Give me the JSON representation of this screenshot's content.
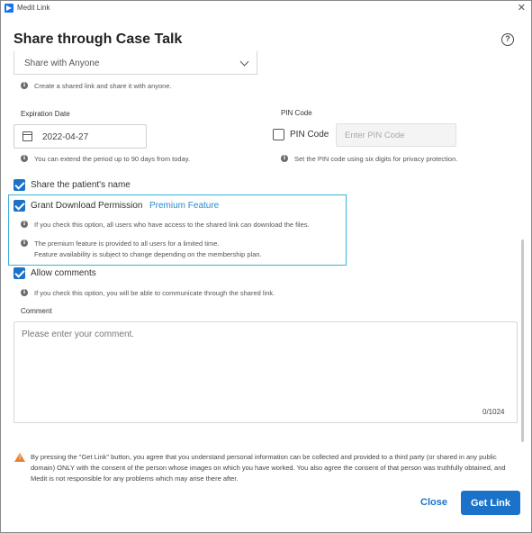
{
  "window": {
    "title": "Medit Link",
    "close_glyph": "✕"
  },
  "dialog": {
    "title": "Share through Case Talk",
    "help_glyph": "?"
  },
  "share": {
    "selected": "Share with Anyone",
    "hint": "Create a shared link and share it with anyone."
  },
  "expiration": {
    "label": "Expiration Date",
    "value": "2022-04-27",
    "hint": "You can extend the period up to 90 days from today."
  },
  "pin": {
    "section_label": "PIN Code",
    "checkbox_label": "PIN Code",
    "checked": false,
    "placeholder": "Enter PIN Code",
    "hint": "Set the PIN code using six digits for privacy protection."
  },
  "share_name": {
    "label": "Share the patient's name",
    "checked": true
  },
  "download": {
    "label": "Grant Download Permission",
    "badge": "Premium Feature",
    "checked": true,
    "hint1": "If you check this option, all users who have access to the shared link can download the files.",
    "hint2_line1": "The premium feature is provided to all users for a limited time.",
    "hint2_line2": "Feature availability is subject to change depending on the membership plan."
  },
  "comments_option": {
    "label": "Allow comments",
    "checked": true,
    "hint": "If you check this option, you will be able to communicate through the shared link."
  },
  "comment": {
    "label": "Comment",
    "placeholder": "Please enter your comment.",
    "counter": "0/1024"
  },
  "disclaimer": "By pressing the \"Get Link\" button, you agree that you understand personal information can be collected and provided to a third party (or shared in any public domain) ONLY with the consent of the person whose images on which you have worked. You also agree the consent of that person was truthfully obtained, and Medit is not responsible for any problems which may arise there after.",
  "buttons": {
    "close": "Close",
    "get_link": "Get Link"
  },
  "info_glyph": "i",
  "warning_glyph": "!",
  "colors": {
    "accent": "#1a73c8",
    "highlight": "#3cb2d8",
    "premium": "#2a8ccb",
    "warning": "#e8822e"
  }
}
